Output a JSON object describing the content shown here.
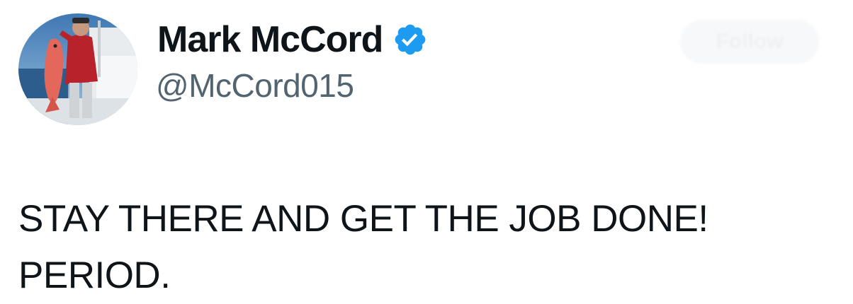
{
  "author": {
    "display_name": "Mark McCord",
    "handle": "@McCord015",
    "verified": true,
    "avatar_description": "man-holding-fish-photo"
  },
  "actions": {
    "follow_label": "Follow"
  },
  "tweet": {
    "text_line_1": "STAY THERE AND GET THE JOB DONE!",
    "text_line_2": "PERIOD."
  },
  "colors": {
    "text_primary": "#0f1419",
    "text_secondary": "#536471",
    "verified_blue": "#1d9bf0",
    "background": "#ffffff"
  }
}
